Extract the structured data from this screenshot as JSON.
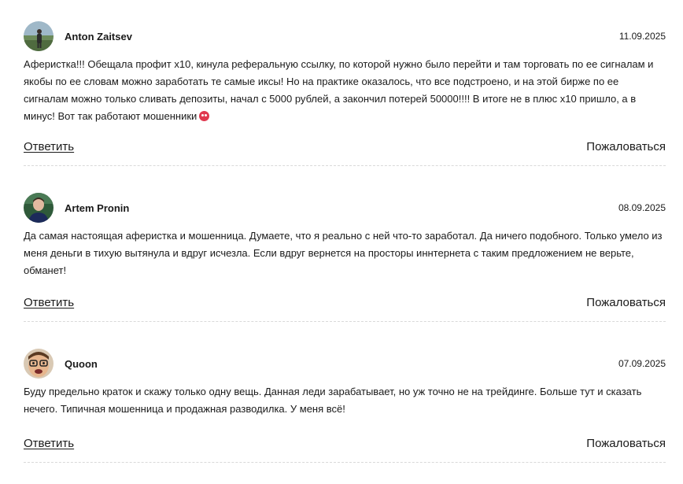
{
  "comments": [
    {
      "author": "Anton Zaitsev",
      "date": "11.09.2025",
      "text": "Аферистка!!! Обещала профит х10, кинула реферальную ссылку, по которой нужно было перейти и там торговать по ее сигналам и якобы по ее словам можно заработать те самые иксы! Но на практике оказалось, что все подстроено, и на этой бирже по ее сигналам можно только сливать депозиты, начал с 5000 рублей, а закончил потерей 50000!!!! В итоге не в плюс х10 пришло, а в минус! Вот так работают мошенники",
      "emoji": "angry-face-emoji",
      "reply_label": "Ответить",
      "report_label": "Пожаловаться"
    },
    {
      "author": "Artem Pronin",
      "date": "08.09.2025",
      "text": "Да самая настоящая аферистка и мошенница. Думаете, что я реально с ней что-то заработал. Да ничего подобного. Только умело из меня деньги в тихую вытянула и вдруг исчезла. Если вдруг вернется на просторы иннтернета с таким предложением не верьте, обманет!",
      "reply_label": "Ответить",
      "report_label": "Пожаловаться"
    },
    {
      "author": "Quoon",
      "date": "07.09.2025",
      "text": "Буду предельно краток и скажу только одну вещь. Данная леди зарабатывает, но уж точно не на трейдинге. Больше тут и сказать нечего. Типичная мошенница и продажная разводилка. У меня всё!",
      "reply_label": "Ответить",
      "report_label": "Пожаловаться"
    }
  ]
}
